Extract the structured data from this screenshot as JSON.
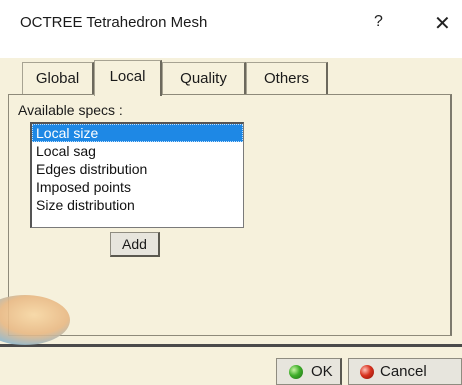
{
  "window": {
    "title": "OCTREE Tetrahedron Mesh",
    "help_label": "?",
    "close_label": "✕"
  },
  "tabs": [
    {
      "label": "Global",
      "active": false
    },
    {
      "label": "Local",
      "active": true
    },
    {
      "label": "Quality",
      "active": false
    },
    {
      "label": "Others",
      "active": false
    }
  ],
  "local_tab": {
    "specs_label": "Available specs :",
    "specs": [
      {
        "label": "Local size",
        "selected": true
      },
      {
        "label": "Local sag",
        "selected": false
      },
      {
        "label": "Edges distribution",
        "selected": false
      },
      {
        "label": "Imposed points",
        "selected": false
      },
      {
        "label": "Size distribution",
        "selected": false
      }
    ],
    "add_label": "Add"
  },
  "footer": {
    "ok_label": "OK",
    "cancel_label": "Cancel",
    "ok_icon": "green-ok-icon",
    "cancel_icon": "red-cancel-icon"
  },
  "colors": {
    "dialog_background": "#f6f1dc",
    "selection": "#1e88e5"
  }
}
